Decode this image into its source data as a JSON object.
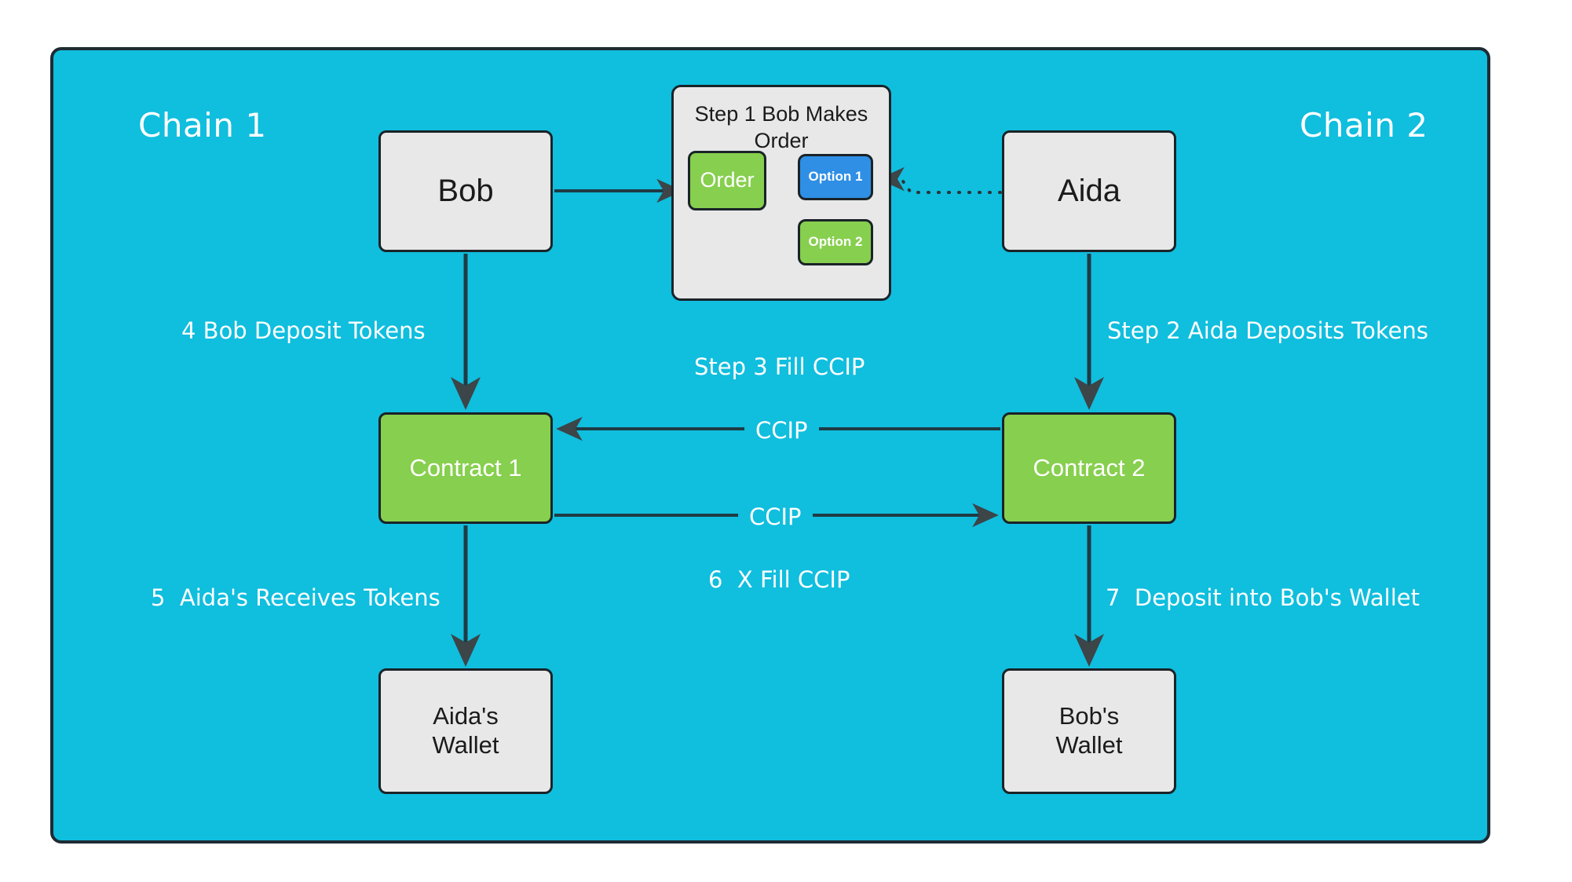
{
  "diagram": {
    "type": "flowchart",
    "background_color": "#ffffff",
    "frame_color": "#10bede",
    "frame_border_color": "#1f2b33",
    "node_grey_color": "#e8e8e8",
    "node_green_color": "#87cf4e",
    "node_blue_color": "#2f8fe5",
    "edge_color": "#1f3b44",
    "label_color": "#ffffff"
  },
  "chains": {
    "left_label": "Chain 1",
    "right_label": "Chain 2"
  },
  "subgraph": {
    "title": "Step 1 Bob Makes\nOrder",
    "nodes": {
      "order": "Order",
      "option1": "Option 1",
      "option2": "Option 2"
    }
  },
  "nodes": {
    "bob": "Bob",
    "aida": "Aida",
    "contract1": "Contract 1",
    "contract2": "Contract 2",
    "aida_wallet": "Aida's\nWallet",
    "bob_wallet": "Bob's\nWallet"
  },
  "edge_labels": {
    "bob_deposit_tokens": "4 Bob Deposit Tokens",
    "aida_deposits_tokens": "Step 2 Aida Deposits Tokens",
    "step3_fill_ccip": "Step 3 Fill CCIP",
    "ccip_top": "CCIP",
    "ccip_bottom": "CCIP",
    "aida_receives_tokens": "5  Aida's Receives Tokens",
    "six_x_fill_ccip": "6  X Fill CCIP",
    "deposit_into_bobs_wallet": "7  Deposit into Bob's Wallet"
  }
}
